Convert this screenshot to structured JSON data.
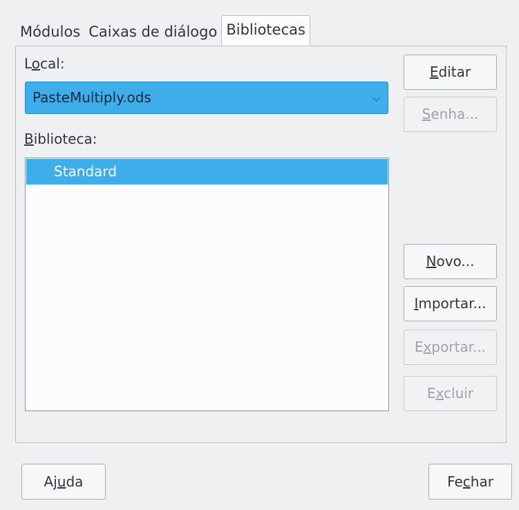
{
  "tabs": {
    "modules": "Módulos",
    "dialogs": "Caixas de diálogo",
    "libraries": "Bibliotecas"
  },
  "location": {
    "label_pre": "L",
    "label_u": "o",
    "label_post": "cal:",
    "value": "PasteMultiply.ods"
  },
  "library": {
    "label_u": "B",
    "label_post": "iblioteca:",
    "items": [
      "Standard"
    ]
  },
  "buttons": {
    "edit": {
      "u": "E",
      "post": "ditar"
    },
    "password": {
      "u": "S",
      "post": "enha..."
    },
    "new": {
      "u": "N",
      "post": "ovo..."
    },
    "import": {
      "u": "I",
      "post": "mportar..."
    },
    "export": {
      "pre": "E",
      "u": "x",
      "post": "portar..."
    },
    "delete": {
      "pre": "E",
      "u": "x",
      "post": "cluir"
    },
    "help": {
      "pre": "Aj",
      "u": "u",
      "post": "da"
    },
    "close": {
      "pre": "Fe",
      "u": "c",
      "post": "har"
    }
  }
}
